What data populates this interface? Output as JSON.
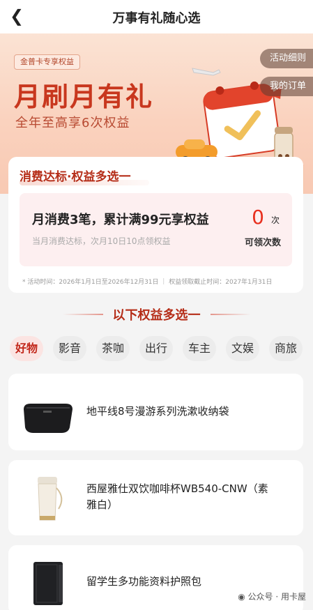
{
  "nav": {
    "title": "万事有礼随心选",
    "back_icon": "chevron-left-icon"
  },
  "banner": {
    "tag": "金普卡专享权益",
    "headline": "月刷月有礼",
    "subline": "全年至高享6次权益",
    "rules_button": "活动细则",
    "orders_button": "我的订单"
  },
  "progress_card": {
    "title": "消费达标·权益多选一",
    "rule": "月消费3笔，累计满99元享权益",
    "rule_detail": "当月消费达标，次月10日10点领权益",
    "count": "0",
    "count_unit": "次",
    "count_label": "可领次数",
    "period": "* 活动时间：2026年1月1日至2026年12月31日 ｜ 权益领取截止时间：2027年1月31日"
  },
  "section": {
    "title": "以下权益多选一"
  },
  "tabs": [
    "好物",
    "影音",
    "茶咖",
    "出行",
    "车主",
    "文娱",
    "商旅"
  ],
  "active_tab": "好物",
  "items": [
    {
      "name": "地平线8号漫游系列洗漱收纳袋",
      "thumb_icon": "toiletry-bag-icon"
    },
    {
      "name_line1": "西屋雅仕双饮咖啡杯WB540-CNW（素",
      "name_line2": "雅白）",
      "thumb_icon": "coffee-cup-icon"
    },
    {
      "name": "留学生多功能资料护照包",
      "thumb_icon": "passport-wallet-icon"
    }
  ],
  "watermark": "公众号 · 用卡屋",
  "colors": {
    "accent": "#c8371e",
    "count_red": "#e8301f",
    "banner_bg": "#fad2be"
  }
}
